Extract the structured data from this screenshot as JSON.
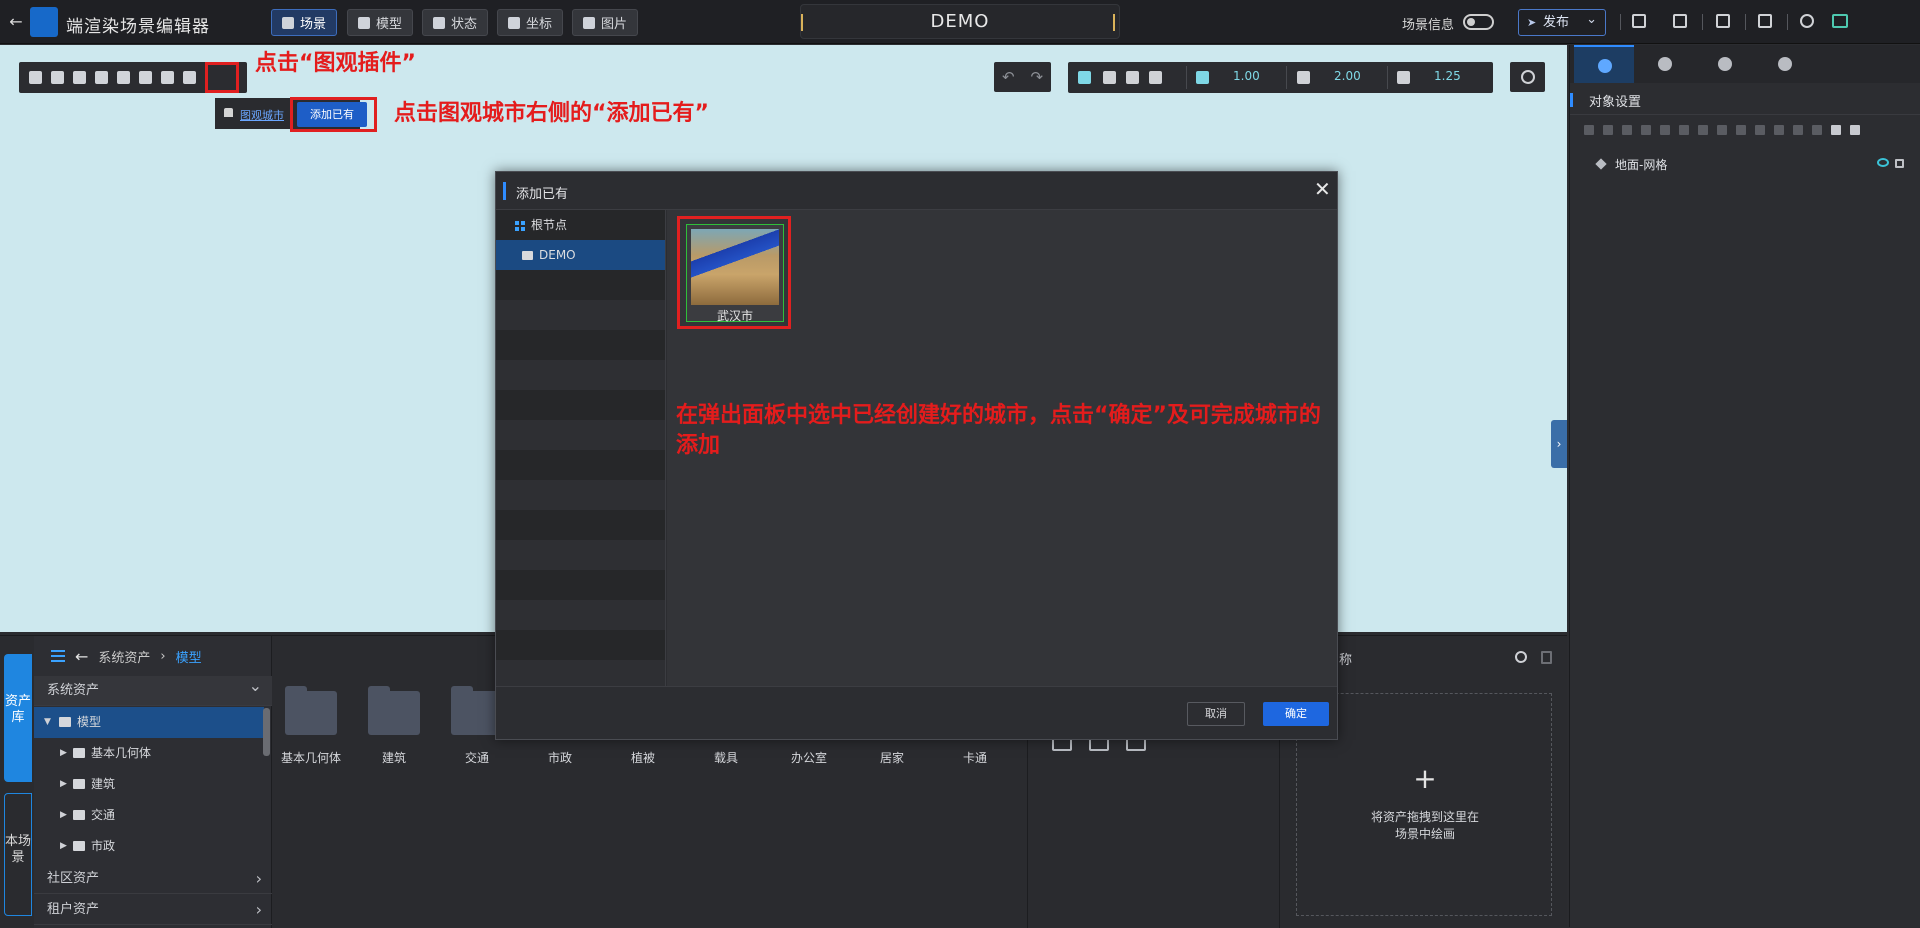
{
  "header": {
    "app_title": "端渲染场景编辑器",
    "nav": [
      {
        "label": "场景",
        "icon": "layers-icon"
      },
      {
        "label": "模型",
        "icon": "cube-icon"
      },
      {
        "label": "状态",
        "icon": "grid-icon"
      },
      {
        "label": "坐标",
        "icon": "pin-icon"
      },
      {
        "label": "图片",
        "icon": "image-icon"
      }
    ],
    "project_name": "DEMO",
    "scene_info_label": "场景信息",
    "scene_info_toggle": "off",
    "publish_label": "发布"
  },
  "viewport": {
    "plugin_popup": {
      "link_label": "图观城市",
      "add_button_label": "添加已有"
    },
    "annotation_plugin": "点击“图观插件”",
    "annotation_add": "点击图观城市右侧的“添加已有”",
    "transform": {
      "grid_value": "1.00",
      "angle_value": "2.00",
      "scale_value": "1.25"
    }
  },
  "dialog": {
    "title": "添加已有",
    "tree": [
      {
        "label": "根节点"
      },
      {
        "label": "DEMO"
      }
    ],
    "items": [
      {
        "label": "武汉市"
      }
    ],
    "annotation": "在弹出面板中选中已经创建好的城市，点击“确定”及可完成城市的添加",
    "cancel_label": "取消",
    "ok_label": "确定"
  },
  "right_panel": {
    "section_title": "对象设置",
    "objects": [
      {
        "label": "地面-网格"
      }
    ]
  },
  "bottom": {
    "vertical_tabs": [
      "资产库",
      "本场景"
    ],
    "breadcrumb": {
      "root": "系统资产",
      "current": "模型"
    },
    "nav_sections": {
      "system": "系统资产",
      "community": "社区资产",
      "tenant": "租户资产"
    },
    "tree": [
      {
        "label": "模型",
        "level": 0
      },
      {
        "label": "基本几何体",
        "level": 1
      },
      {
        "label": "建筑",
        "level": 1
      },
      {
        "label": "交通",
        "level": 1
      },
      {
        "label": "市政",
        "level": 1
      }
    ],
    "assets": [
      "基本几何体",
      "建筑",
      "交通",
      "市政",
      "植被",
      "载具",
      "办公室",
      "居家",
      "卡通"
    ],
    "name_label": "名称",
    "drop_hint_line1": "将资产拖拽到这里在",
    "drop_hint_line2": "场景中绘画",
    "drop_plus": "+"
  }
}
